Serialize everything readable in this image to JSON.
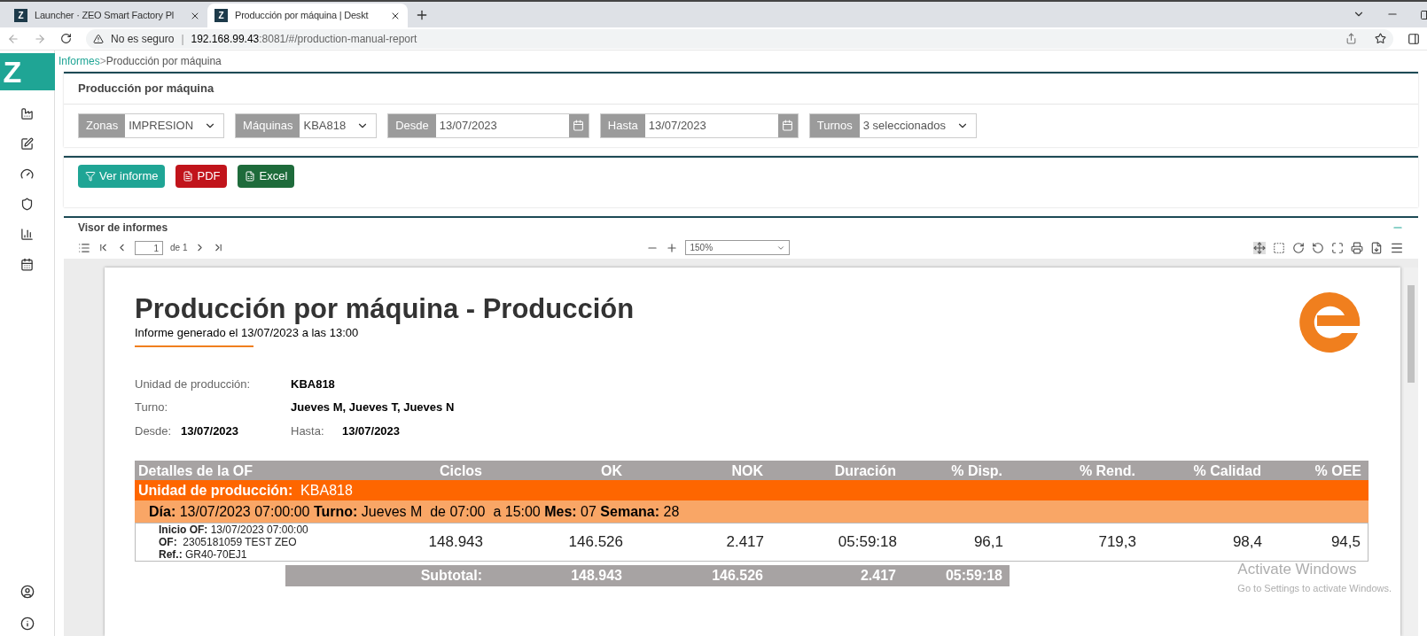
{
  "browser": {
    "tabs": [
      {
        "favicon": "Z",
        "title": "Launcher · ZEO Smart Factory Pl",
        "selected": false
      },
      {
        "favicon": "Z",
        "title": "Producción por máquina | Deskt",
        "selected": true
      }
    ],
    "security": "No es seguro",
    "url_separator": "|",
    "url_host": "192.168.99.43",
    "url_rest": ":8081/#/production-manual-report"
  },
  "app": {
    "logo": "Z",
    "breadcrumb": {
      "parent": "Informes",
      "separator": ">",
      "current": "Producción por máquina"
    }
  },
  "filters_panel": {
    "title": "Producción por máquina",
    "filters": [
      {
        "kind": "select",
        "label": "Zonas",
        "value": "IMPRESION"
      },
      {
        "kind": "select",
        "label": "Máquinas",
        "value": "KBA818"
      },
      {
        "kind": "date",
        "label": "Desde",
        "value": "13/07/2023"
      },
      {
        "kind": "date",
        "label": "Hasta",
        "value": "13/07/2023"
      },
      {
        "kind": "select",
        "label": "Turnos",
        "value": "3 seleccionados"
      }
    ]
  },
  "actions": [
    {
      "kind": "filter",
      "label": "Ver informe"
    },
    {
      "kind": "pdf",
      "label": "PDF"
    },
    {
      "kind": "excel",
      "label": "Excel"
    }
  ],
  "viewer": {
    "title": "Visor de informes",
    "page": "1",
    "page_of": "de 1",
    "zoom": "150%"
  },
  "report": {
    "title": "Producción por máquina - Producción",
    "generated": "Informe generado el 13/07/2023 a las 13:00",
    "info": [
      {
        "label": "Unidad de producción:",
        "value": "KBA818"
      },
      {
        "label": "Turno:",
        "value": "Jueves M, Jueves T, Jueves N"
      }
    ],
    "desde_label": "Desde:",
    "desde": "13/07/2023",
    "hasta_label": "Hasta:",
    "hasta": "13/07/2023",
    "columns": [
      "Detalles de la OF",
      "Ciclos",
      "OK",
      "NOK",
      "Duración",
      "% Disp.",
      "% Rend.",
      "% Calidad",
      "% OEE"
    ],
    "group": "**Unidad de producción:**  KBA818",
    "day": "**Día:** 13/07/2023 07:00:00 **Turno:** Jueves M  de 07:00  a 15:00 **Mes:** 07 **Semana:** 28",
    "row": {
      "details": [
        "**Inicio OF:** 13/07/2023 07:00:00",
        "**OF:**  2305181059 TEST ZEO",
        "**Ref.:** GR40-70EJ1"
      ],
      "values": [
        "148.943",
        "146.526",
        "2.417",
        "05:59:18",
        "96,1",
        "719,3",
        "98,4",
        "94,5"
      ]
    },
    "subtotal": {
      "label": "Subtotal:",
      "values": [
        "148.943",
        "146.526",
        "2.417",
        "05:59:18"
      ]
    }
  },
  "os_notice": {
    "title": "Activate Windows",
    "subtitle": "Go to Settings to activate Windows."
  }
}
